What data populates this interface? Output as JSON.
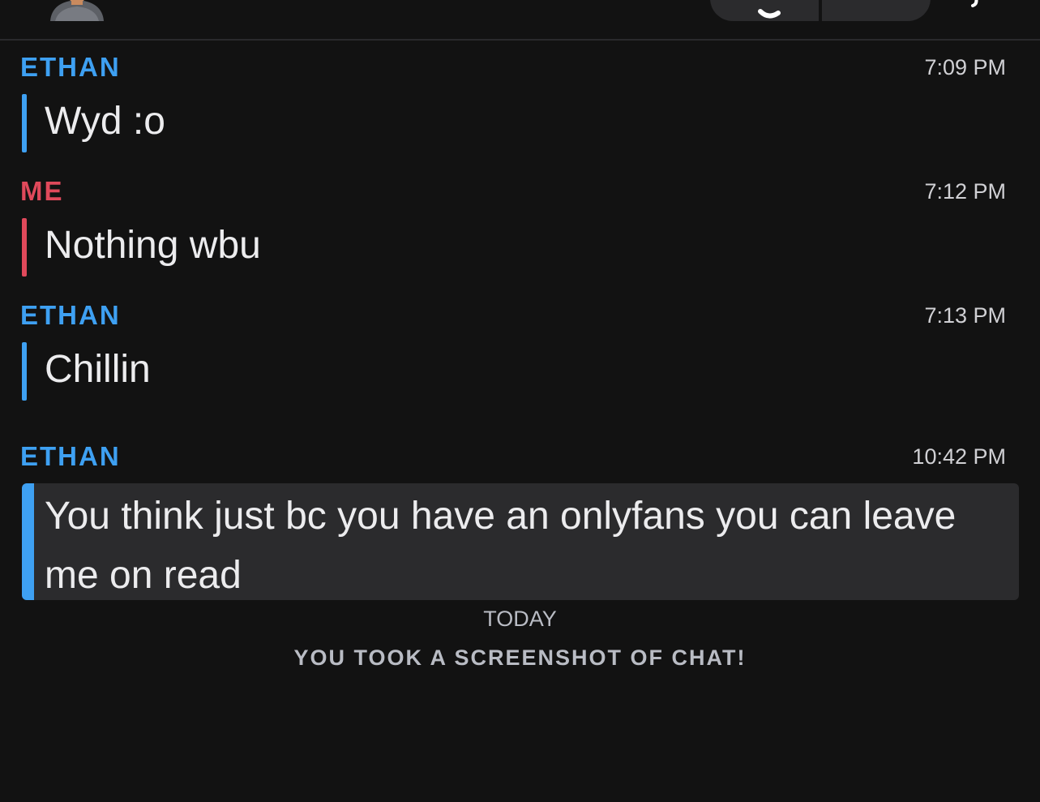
{
  "header": {
    "avatar_icon": "bitmoji-avatar-icon",
    "call_icon": "phone-icon",
    "video_icon": "video-camera-icon",
    "more_icon": "more-icon"
  },
  "colors": {
    "ethan": "#3ea0f2",
    "me": "#e0495b",
    "background": "#121212",
    "highlight": "#2b2b2d"
  },
  "messages": [
    {
      "sender": "ETHAN",
      "time": "7:09 PM",
      "text": "Wyd :o"
    },
    {
      "sender": "ME",
      "time": "7:12 PM",
      "text": "Nothing wbu"
    },
    {
      "sender": "ETHAN",
      "time": "7:13 PM",
      "text": "Chillin"
    },
    {
      "sender": "ETHAN",
      "time": "10:42 PM",
      "text": "You think just bc you have an onlyfans you can leave me on read"
    }
  ],
  "system": {
    "date_label": "TODAY",
    "screenshot_notice": "YOU TOOK A SCREENSHOT OF CHAT!"
  }
}
